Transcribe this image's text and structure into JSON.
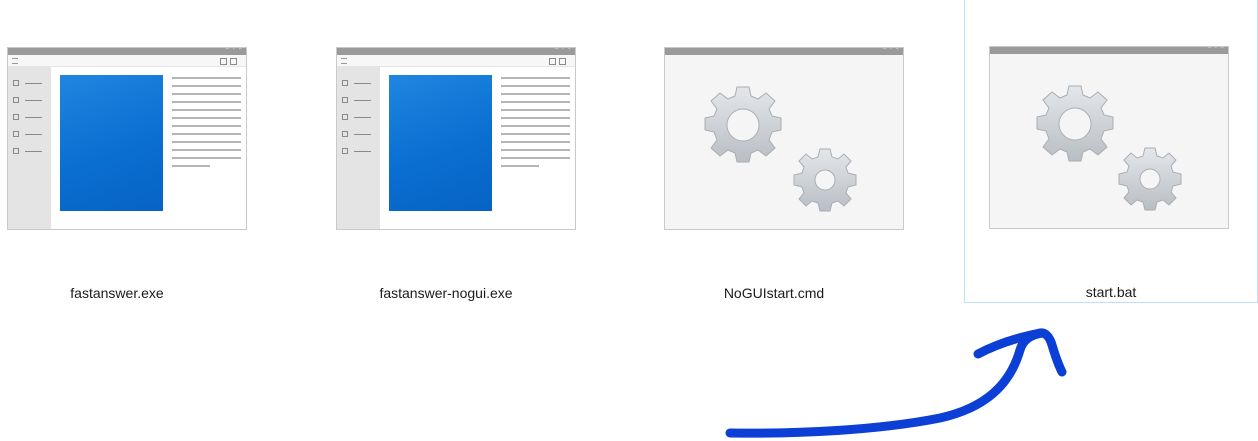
{
  "files": [
    {
      "name": "fastanswer.exe",
      "kind": "app-window-icon",
      "selected": false
    },
    {
      "name": "fastanswer-nogui.exe",
      "kind": "app-window-icon",
      "selected": false
    },
    {
      "name": "NoGUIstart.cmd",
      "kind": "gears-icon",
      "selected": false
    },
    {
      "name": "start.bat",
      "kind": "gears-icon",
      "selected": true
    }
  ],
  "colors": {
    "selection_border": "#bfe1f7",
    "annotation_arrow": "#0b3fd6",
    "app_panel_blue": "#0a6fd1",
    "gear_fill": "#d4d8dc"
  },
  "annotation": {
    "type": "hand-drawn-arrow",
    "points_to": "start.bat"
  }
}
